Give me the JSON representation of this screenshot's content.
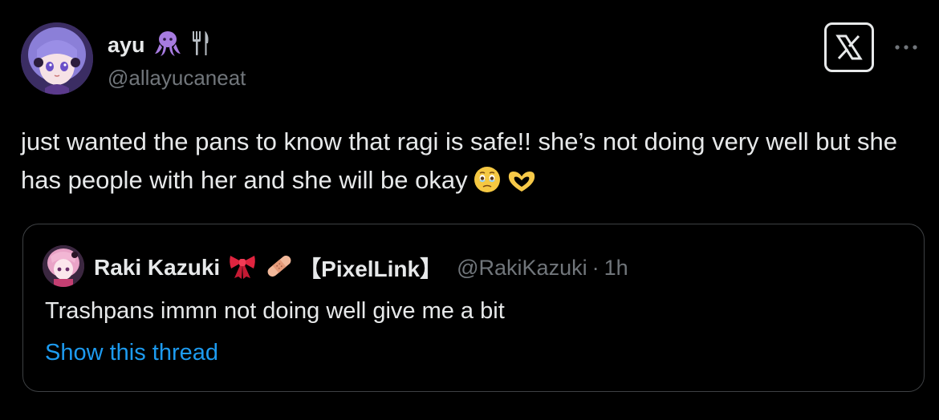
{
  "author": {
    "display_name": "ayu",
    "handle": "@allayucaneat",
    "avatar_icon": "anime-girl-avatar",
    "name_emojis": [
      "octopus-emoji",
      "fork-knife-icon"
    ]
  },
  "header": {
    "logo_icon": "x-logo-icon",
    "more_icon": "more-options-icon"
  },
  "tweet": {
    "text": "just wanted the pans to know that ragi is safe!! she’s not doing very well but she has people with her and she will be okay",
    "trailing_emojis": [
      "holding-back-tears-emoji",
      "heart-hands-emoji"
    ]
  },
  "quote": {
    "display_name": "Raki Kazuki",
    "name_emojis": [
      "ribbon-emoji",
      "bandage-emoji"
    ],
    "tag": "【PixelLink】",
    "handle": "@RakiKazuki",
    "separator": "·",
    "time": "1h",
    "text": "Trashpans immn not doing well give me a bit",
    "show_thread_label": "Show this thread",
    "link_color": "#1d9bf0"
  },
  "colors": {
    "background": "#000000",
    "text": "#e7e9ea",
    "secondary": "#71767b",
    "border": "#3e4144",
    "accent": "#1d9bf0"
  }
}
